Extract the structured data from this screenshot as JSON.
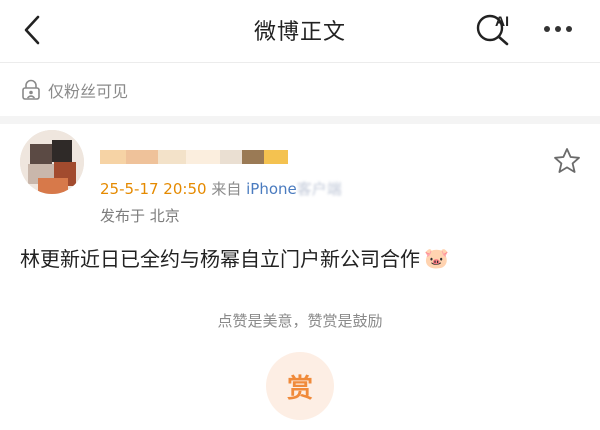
{
  "nav": {
    "title": "微博正文",
    "ai_label": "AI"
  },
  "visibility": {
    "label": "仅粉丝可见"
  },
  "post": {
    "date": "25-5-17 20:50",
    "source_prefix": "来自",
    "client": "iPhone",
    "client_suffix": "客户端",
    "location": "发布于 北京",
    "text": "林更新近日已全约与杨幂自立门户新公司合作",
    "emoji": "🐷"
  },
  "reward": {
    "tip": "点赞是美意，赞赏是鼓励",
    "button_label": "赏"
  },
  "colors": {
    "date": "#e58a00",
    "client": "#4a7bbf",
    "reward_bg": "#fdeee4",
    "reward_fg": "#f08a3a"
  },
  "icons": {
    "back": "chevron-left-icon",
    "ai_search": "ai-search-icon",
    "more": "more-dots-icon",
    "lock": "lock-person-icon",
    "star": "star-outline-icon"
  }
}
